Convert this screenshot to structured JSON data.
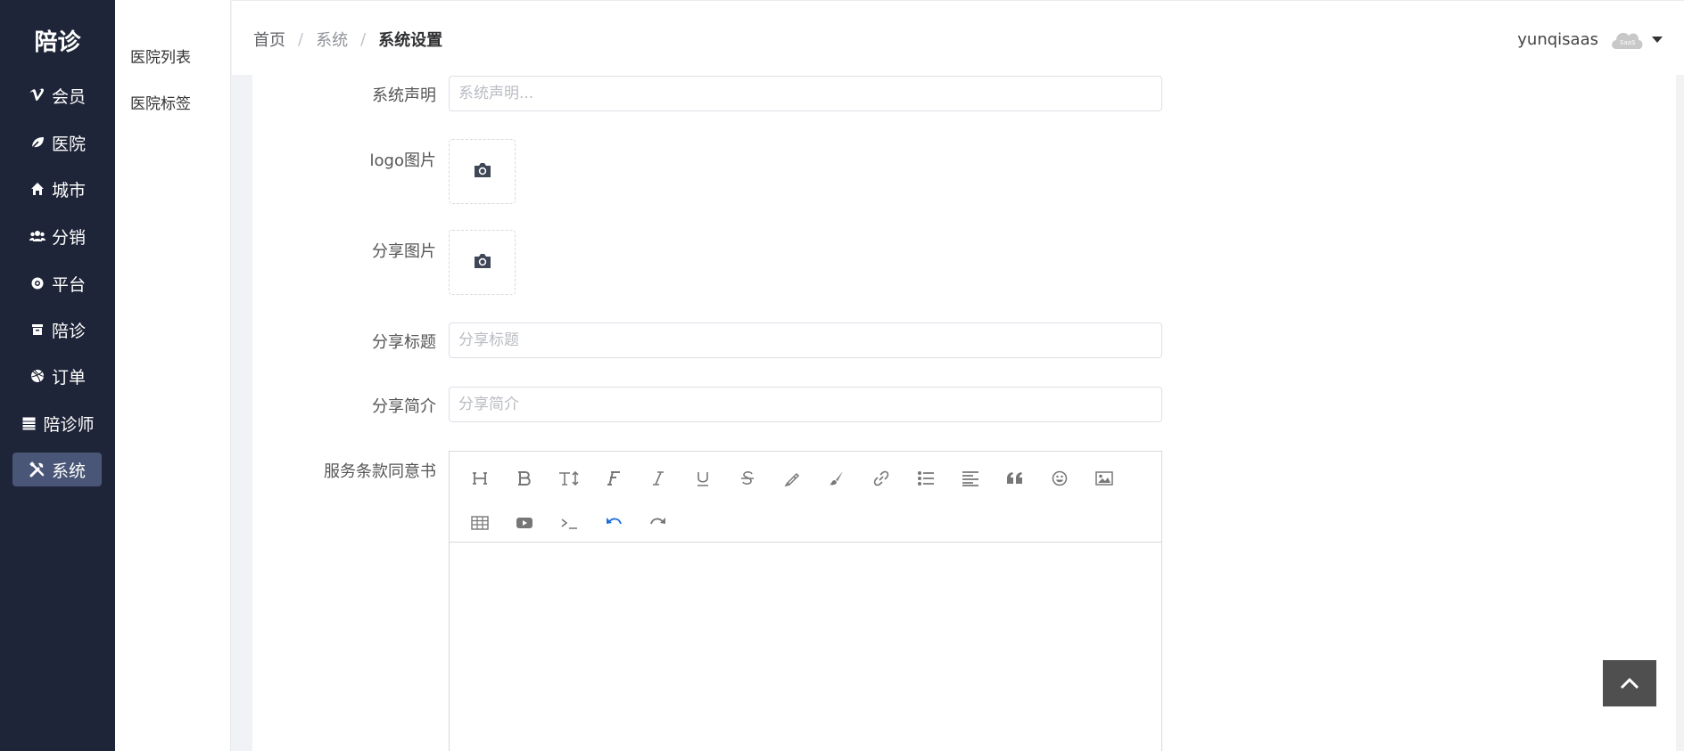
{
  "sidebar": {
    "brand": "陪诊",
    "items": [
      {
        "label": "会员",
        "icon": "vimeo-icon"
      },
      {
        "label": "医院",
        "icon": "leaf-icon"
      },
      {
        "label": "城市",
        "icon": "home-icon"
      },
      {
        "label": "分销",
        "icon": "users-icon"
      },
      {
        "label": "平台",
        "icon": "gear-icon"
      },
      {
        "label": "陪诊",
        "icon": "archive-icon"
      },
      {
        "label": "订单",
        "icon": "dribbble-icon"
      },
      {
        "label": "陪诊师",
        "icon": "table-icon"
      },
      {
        "label": "系统",
        "icon": "tools-icon",
        "active": true
      }
    ]
  },
  "subnav": {
    "items": [
      {
        "label": "医院列表"
      },
      {
        "label": "医院标签"
      }
    ]
  },
  "header": {
    "breadcrumb": {
      "home": "首页",
      "parent": "系统",
      "current": "系统设置",
      "separator": "/"
    },
    "user": {
      "name": "yunqisaas",
      "avatar_text": "SaaS"
    }
  },
  "form": {
    "statement": {
      "label": "系统声明",
      "placeholder": "系统声明...",
      "value": ""
    },
    "logo": {
      "label": "logo图片"
    },
    "share_image": {
      "label": "分享图片"
    },
    "share_title": {
      "label": "分享标题",
      "placeholder": "分享标题",
      "value": ""
    },
    "share_intro": {
      "label": "分享简介",
      "placeholder": "分享简介",
      "value": ""
    },
    "agreement": {
      "label": "服务条款同意书"
    }
  },
  "editor_tools": [
    "heading",
    "bold",
    "font-size",
    "font-family",
    "italic",
    "underline",
    "strikethrough",
    "highlight",
    "brush",
    "link",
    "list",
    "align",
    "quote",
    "emoji",
    "image",
    "table",
    "video",
    "code",
    "undo",
    "redo"
  ],
  "colors": {
    "sidebar_bg": "#1f2538",
    "sidebar_active": "#4a5677",
    "undo_accent": "#1e6fd9",
    "back_top_bg": "#4f4f4f"
  }
}
